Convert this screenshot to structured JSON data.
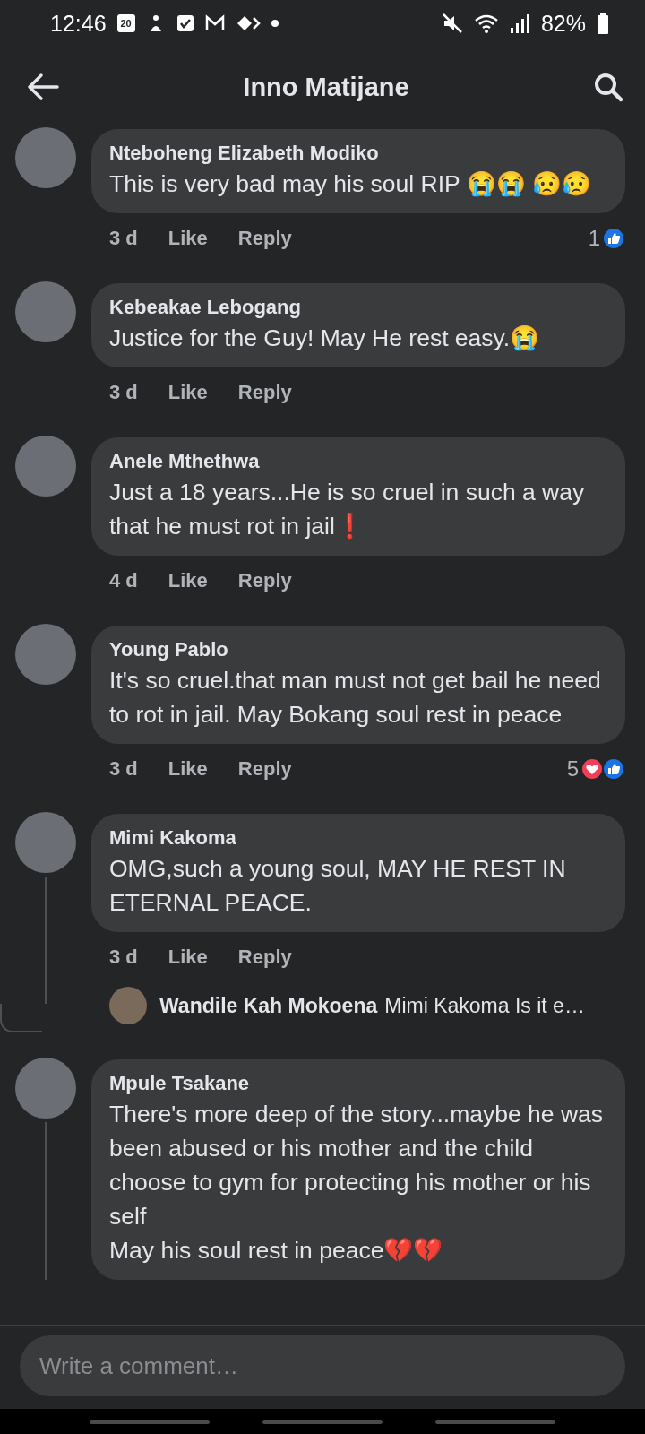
{
  "status_bar": {
    "time": "12:46",
    "calendar_day": "20",
    "battery": "82%"
  },
  "header": {
    "title": "Inno Matijane"
  },
  "comments": [
    {
      "author": "Nteboheng Elizabeth Modiko",
      "text": "This is very bad may his soul RIP 😭😭 😥😥",
      "time": "3 d",
      "like": "Like",
      "reply": "Reply",
      "reactions": {
        "count": "1",
        "love": false,
        "like": true
      },
      "has_replies": false
    },
    {
      "author": "Kebeakae Lebogang",
      "text": "Justice for the Guy! May He rest easy.😭",
      "time": "3 d",
      "like": "Like",
      "reply": "Reply",
      "has_replies": false
    },
    {
      "author": "Anele Mthethwa",
      "text": "Just a 18 years...He is so cruel in such a way that he must rot in jail❗",
      "time": "4 d",
      "like": "Like",
      "reply": "Reply",
      "has_replies": false
    },
    {
      "author": "Young Pablo",
      "text": "It's so cruel.that man must not get bail he need to rot in jail. May Bokang soul rest in peace",
      "time": "3 d",
      "like": "Like",
      "reply": "Reply",
      "reactions": {
        "count": "5",
        "love": true,
        "like": true
      },
      "has_replies": false
    },
    {
      "author": "Mimi Kakoma",
      "text": "OMG,such a young soul, MAY HE REST IN ETERNAL PEACE.",
      "time": "3 d",
      "like": "Like",
      "reply": "Reply",
      "has_replies": true,
      "replies": [
        {
          "author": "Wandile Kah Mokoena",
          "text": "Mimi Kakoma Is it e…"
        }
      ]
    },
    {
      "author": "Mpule Tsakane",
      "text": "There's more deep of the story...maybe he was been abused or his mother and the child choose to gym for protecting his mother or his self\nMay his soul rest in peace💔💔",
      "has_replies": true
    }
  ],
  "composer": {
    "placeholder": "Write a comment…"
  }
}
